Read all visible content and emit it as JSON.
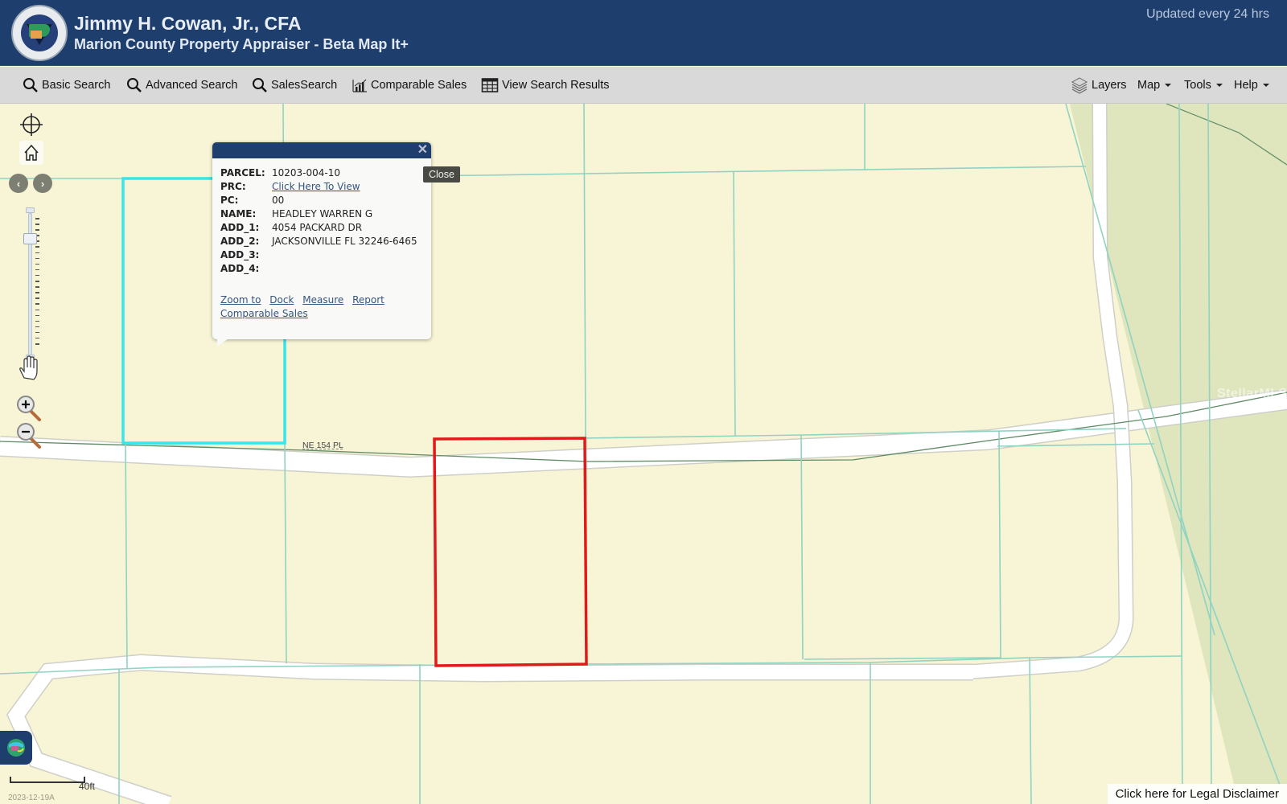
{
  "header": {
    "title": "Jimmy H. Cowan, Jr., CFA",
    "subtitle": "Marion County Property Appraiser - Beta Map It+",
    "updated_note": "Updated every 24 hrs",
    "logo_icon": "property-appraiser-seal"
  },
  "toolbar": {
    "left_items": [
      {
        "label": "Basic Search",
        "icon": "search-icon"
      },
      {
        "label": "Advanced Search",
        "icon": "search-icon"
      },
      {
        "label": "SalesSearch",
        "icon": "search-icon"
      },
      {
        "label": "Comparable Sales",
        "icon": "bar-chart-icon"
      },
      {
        "label": "View Search Results",
        "icon": "table-grid-icon"
      }
    ],
    "right_items": [
      {
        "label": "Layers",
        "icon": "layers-icon"
      },
      {
        "label": "Map",
        "dropdown": true
      },
      {
        "label": "Tools",
        "dropdown": true
      },
      {
        "label": "Help",
        "dropdown": true
      }
    ]
  },
  "map_controls": {
    "locate_icon": "crosshair-icon",
    "home_icon": "home-icon",
    "prev_extent": "‹",
    "next_extent": "›",
    "pan_icon": "hand-icon",
    "zoom_in_icon": "zoom-in-icon",
    "zoom_out_icon": "zoom-out-icon",
    "zoom_level_fraction": 0.14
  },
  "map": {
    "street_label": "NE 154 PL",
    "selected_parcel_color": "#e0191b",
    "highlighted_parcel_color": "#36e6ea",
    "parcel_line_color": "#8fd3c3",
    "land_color": "#f8f5d6",
    "green_area_color": "#dfe5bd",
    "watermark": "StellarMLS"
  },
  "popup": {
    "fields": [
      {
        "key": "PARCEL:",
        "value": "10203-004-10"
      },
      {
        "key": "PRC:",
        "value": "Click Here To View",
        "link": true
      },
      {
        "key": "PC:",
        "value": "00"
      },
      {
        "key": "NAME:",
        "value": "HEADLEY WARREN G"
      },
      {
        "key": "ADD_1:",
        "value": "4054 PACKARD DR"
      },
      {
        "key": "ADD_2:",
        "value": "JACKSONVILLE FL 32246-6465"
      },
      {
        "key": "ADD_3:",
        "value": ""
      },
      {
        "key": "ADD_4:",
        "value": ""
      }
    ],
    "actions": [
      "Zoom to",
      "Dock",
      "Measure",
      "Report",
      "Comparable Sales"
    ],
    "close_glyph": "✕",
    "close_tooltip": "Close"
  },
  "footer": {
    "scale_label": "40ft",
    "date_label": "2023-12-19A",
    "legal_link": "Click here for Legal Disclaimer",
    "basemap_icon": "globe-icon"
  }
}
